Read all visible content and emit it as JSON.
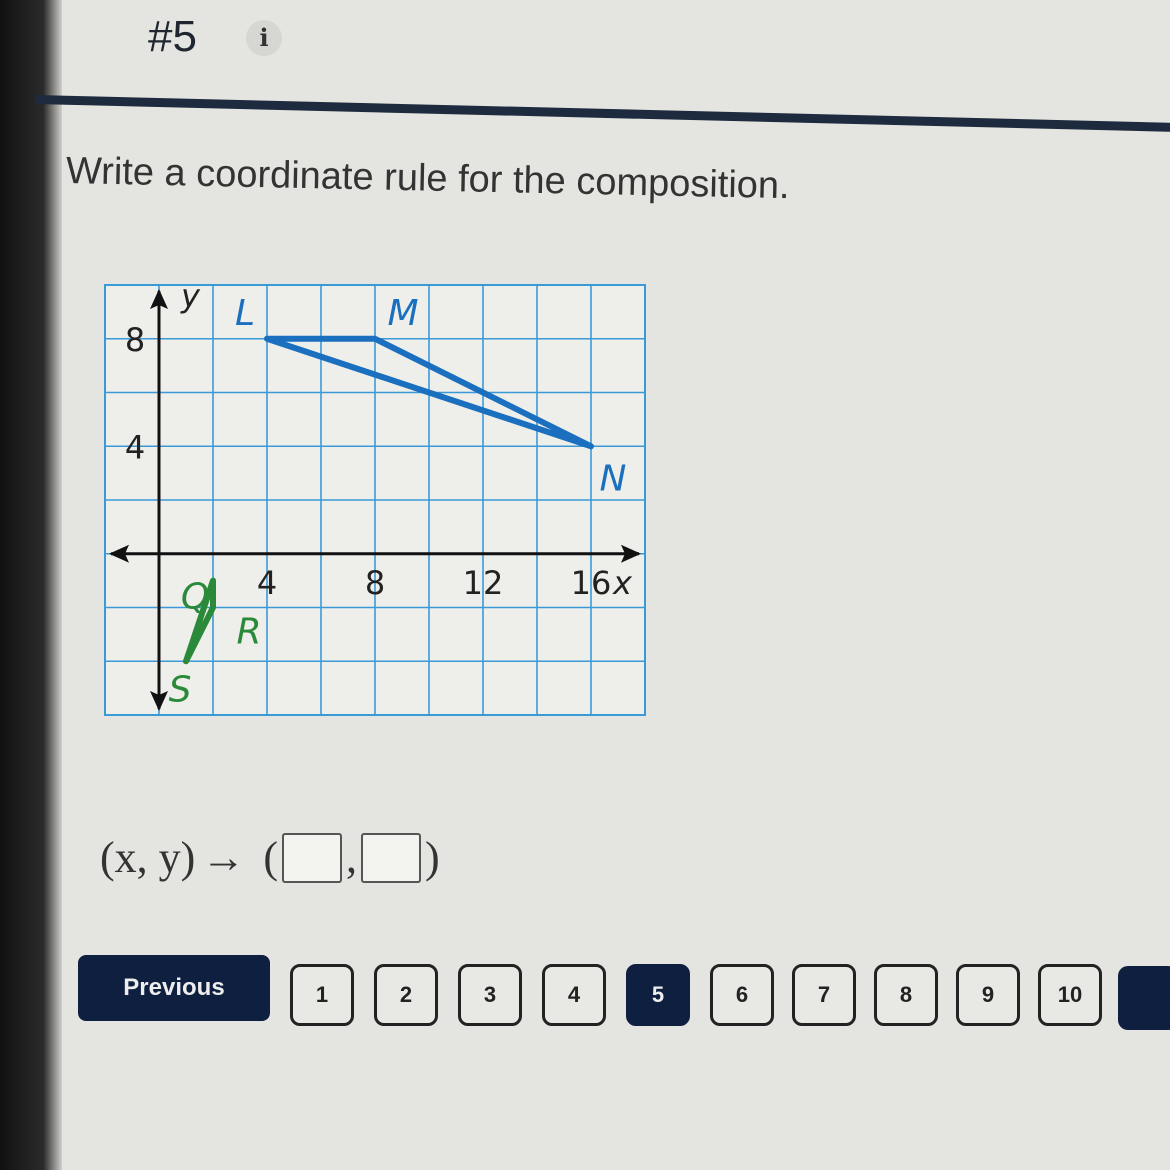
{
  "question": {
    "number": "#5",
    "info_icon": "i",
    "prompt": "Write a coordinate rule for the composition."
  },
  "chart_data": {
    "type": "line",
    "title": "",
    "xlabel": "x",
    "ylabel": "y",
    "xlim": [
      -2,
      18
    ],
    "ylim": [
      -6,
      10
    ],
    "grid_step": 2,
    "grid": true,
    "x_ticks": [
      4,
      8,
      12,
      16
    ],
    "y_ticks": [
      4,
      8
    ],
    "series": [
      {
        "name": "triangle LMN",
        "color": "#1a6fbf",
        "points": [
          {
            "label": "L",
            "x": 4,
            "y": 8
          },
          {
            "label": "M",
            "x": 8,
            "y": 8
          },
          {
            "label": "N",
            "x": 16,
            "y": 4
          }
        ]
      },
      {
        "name": "triangle QRS",
        "color": "#2a8a3a",
        "points": [
          {
            "label": "Q",
            "x": 2,
            "y": -1
          },
          {
            "label": "R",
            "x": 2,
            "y": -2
          },
          {
            "label": "S",
            "x": 1,
            "y": -4
          }
        ]
      }
    ]
  },
  "answer": {
    "lhs": "(x, y)",
    "arrow": "→",
    "open": "(",
    "comma": ",",
    "close": ")",
    "x_value": "",
    "y_value": ""
  },
  "nav": {
    "previous": "Previous",
    "pages": [
      "1",
      "2",
      "3",
      "4",
      "5",
      "6",
      "7",
      "8",
      "9",
      "10"
    ],
    "current": "5"
  }
}
